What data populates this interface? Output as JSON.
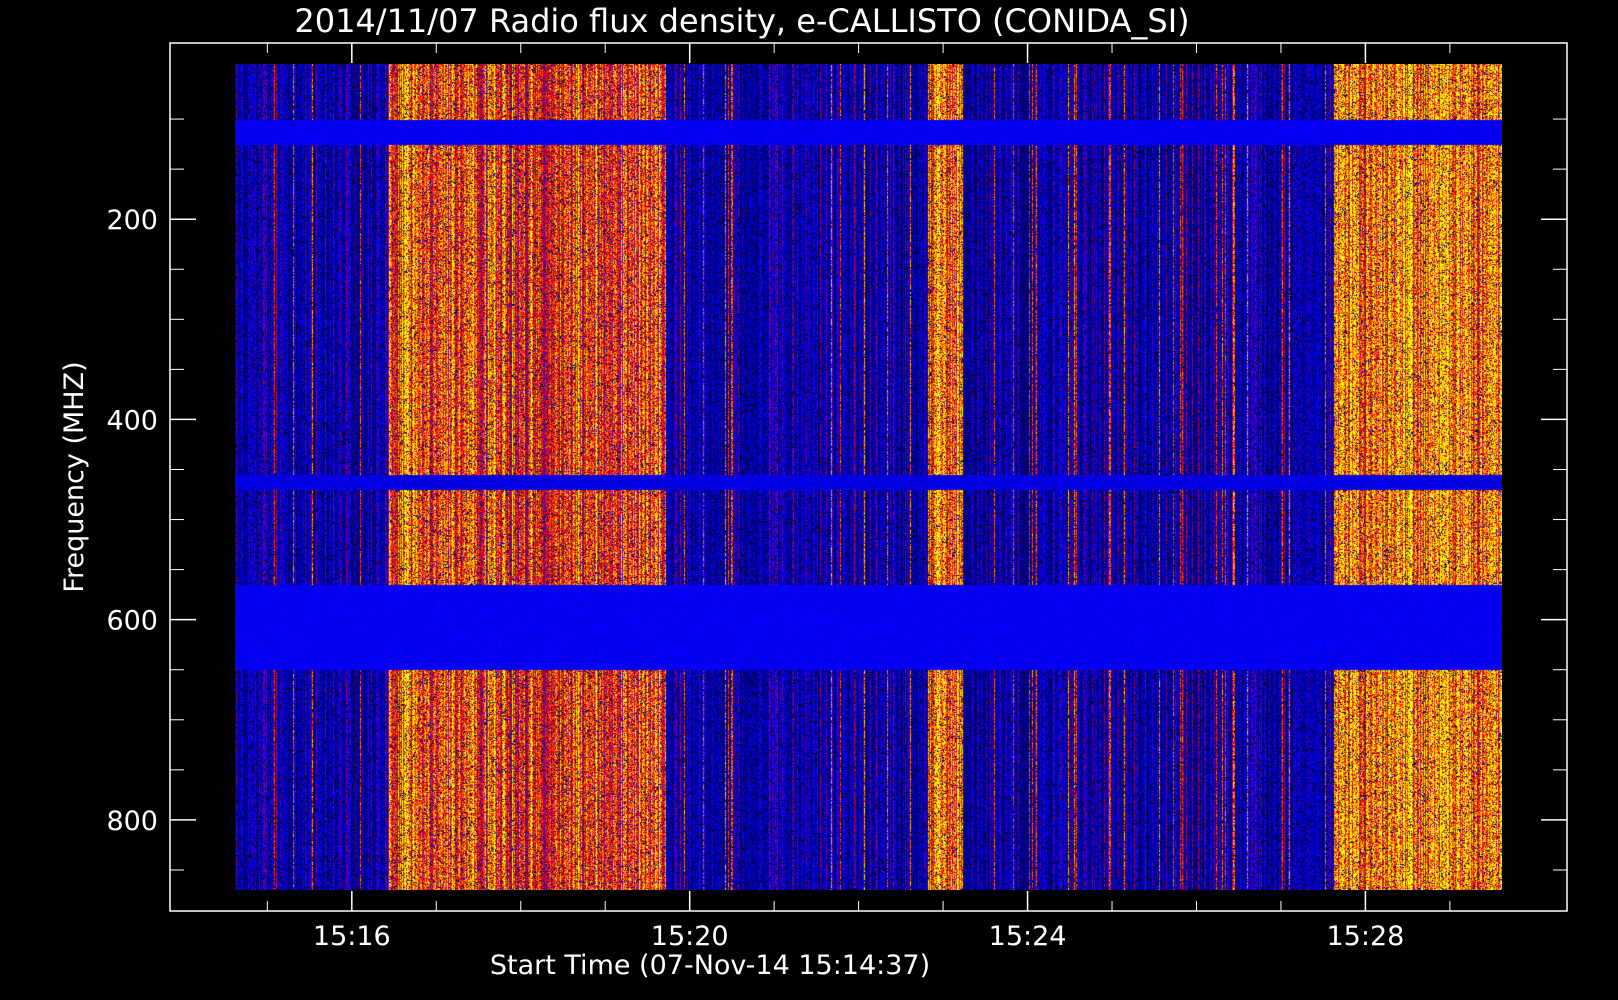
{
  "chart_data": {
    "type": "heatmap",
    "title": "2014/11/07  Radio flux density, e-CALLISTO (CONIDA_SI)",
    "xlabel": "Start Time (07-Nov-14 15:14:37)",
    "ylabel": "Frequency (MHZ)",
    "x_range": [
      "15:14:37",
      "15:29:37"
    ],
    "y_range_mhz": [
      45,
      870
    ],
    "y_axis_inverted": true,
    "x_ticks": [
      {
        "label": "15:16",
        "minutes_from_start": 1.383
      },
      {
        "label": "15:20",
        "minutes_from_start": 5.383
      },
      {
        "label": "15:24",
        "minutes_from_start": 9.383
      },
      {
        "label": "15:28",
        "minutes_from_start": 13.383
      }
    ],
    "y_ticks": [
      200,
      400,
      600,
      800
    ],
    "colormap": [
      "#000000",
      "#0000ff",
      "#ff0000",
      "#ffff00"
    ],
    "strong_bands_mhz": [
      {
        "from": 565,
        "to": 650,
        "level": "high"
      },
      {
        "from": 100,
        "to": 125,
        "level": "high"
      },
      {
        "from": 455,
        "to": 470,
        "level": "medium"
      }
    ],
    "bursty_time_windows_min": [
      {
        "from": 1.8,
        "to": 5.1,
        "intensity": 0.8
      },
      {
        "from": 8.2,
        "to": 8.6,
        "intensity": 0.9
      },
      {
        "from": 13.0,
        "to": 15.0,
        "intensity": 1.0
      }
    ]
  }
}
